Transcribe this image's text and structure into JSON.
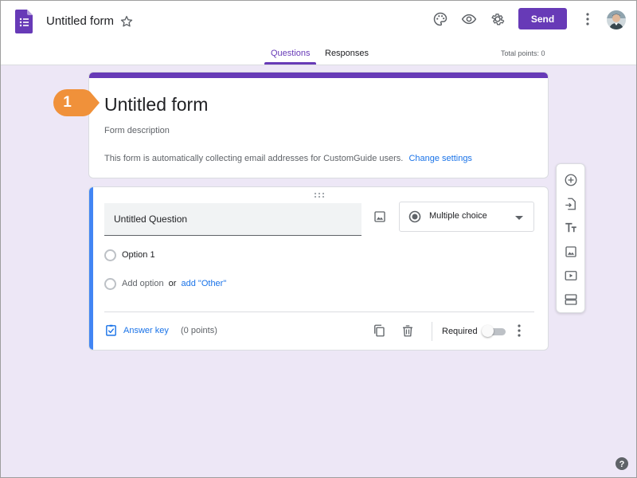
{
  "header": {
    "title": "Untitled form",
    "send_label": "Send",
    "tabs": [
      {
        "label": "Questions",
        "active": true
      },
      {
        "label": "Responses",
        "active": false
      }
    ],
    "total_points": "Total points: 0",
    "icons": [
      "forms-app-icon",
      "star-icon",
      "palette-icon",
      "preview-eye-icon",
      "settings-gear-icon",
      "more-vert-icon",
      "avatar"
    ]
  },
  "form": {
    "title": "Untitled form",
    "description_placeholder": "Form description",
    "email_note": "This form is automatically collecting email addresses for CustomGuide users.",
    "change_settings": "Change settings"
  },
  "callout": {
    "number": "1",
    "color": "#f0913a"
  },
  "question": {
    "title": "Untitled Question",
    "type": "Multiple choice",
    "option1": "Option 1",
    "add_option": "Add option",
    "or": "or",
    "add_other": "add \"Other\"",
    "answer_key": "Answer key",
    "points": "(0 points)",
    "required_label": "Required",
    "required": false
  },
  "toolbar": {
    "items": [
      "add-question-icon",
      "import-questions-icon",
      "add-title-icon",
      "add-image-icon",
      "add-video-icon",
      "add-section-icon"
    ]
  },
  "colors": {
    "accent": "#673ab7",
    "background": "#ede7f6",
    "link": "#1a73e8",
    "question_bar": "#4285f4"
  }
}
